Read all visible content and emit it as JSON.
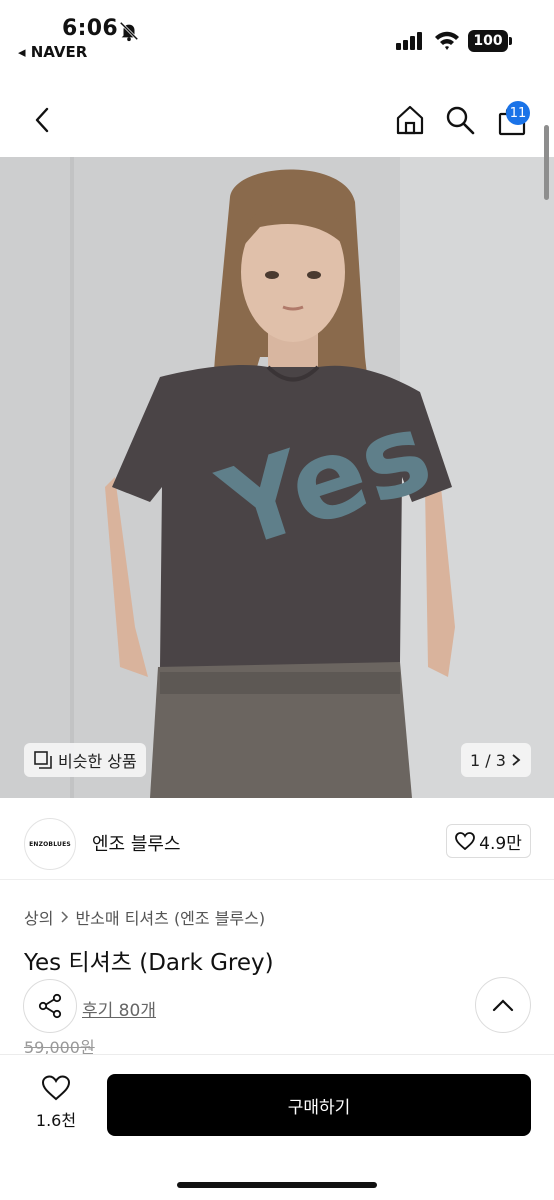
{
  "status_bar": {
    "time": "6:06",
    "back_app": "◂ NAVER",
    "battery": "100"
  },
  "nav": {
    "cart_badge": "11",
    "icons": [
      "back-icon",
      "home-icon",
      "search-icon",
      "cart-icon"
    ]
  },
  "product_image": {
    "similar_label": "비슷한 상품",
    "counter": "1 / 3",
    "graphic_text": "Yes",
    "colors": {
      "background": "#cfd0d1",
      "shirt": "#4a4446",
      "print": "#5f7f8a"
    }
  },
  "brand": {
    "logo_text": "ENZOBLUES",
    "name": "엔조 블루스",
    "likes": "4.9만"
  },
  "breadcrumb": {
    "category": "상의",
    "subcategory": "반소매 티셔츠 (엔조 블루스)"
  },
  "product": {
    "title": "Yes 티셔츠 (Dark Grey)",
    "reviews": "후기 80개",
    "original_price": "59,000원"
  },
  "bottom_bar": {
    "like_count": "1.6천",
    "buy_label": "구매하기",
    "buy_color": "#000000"
  }
}
